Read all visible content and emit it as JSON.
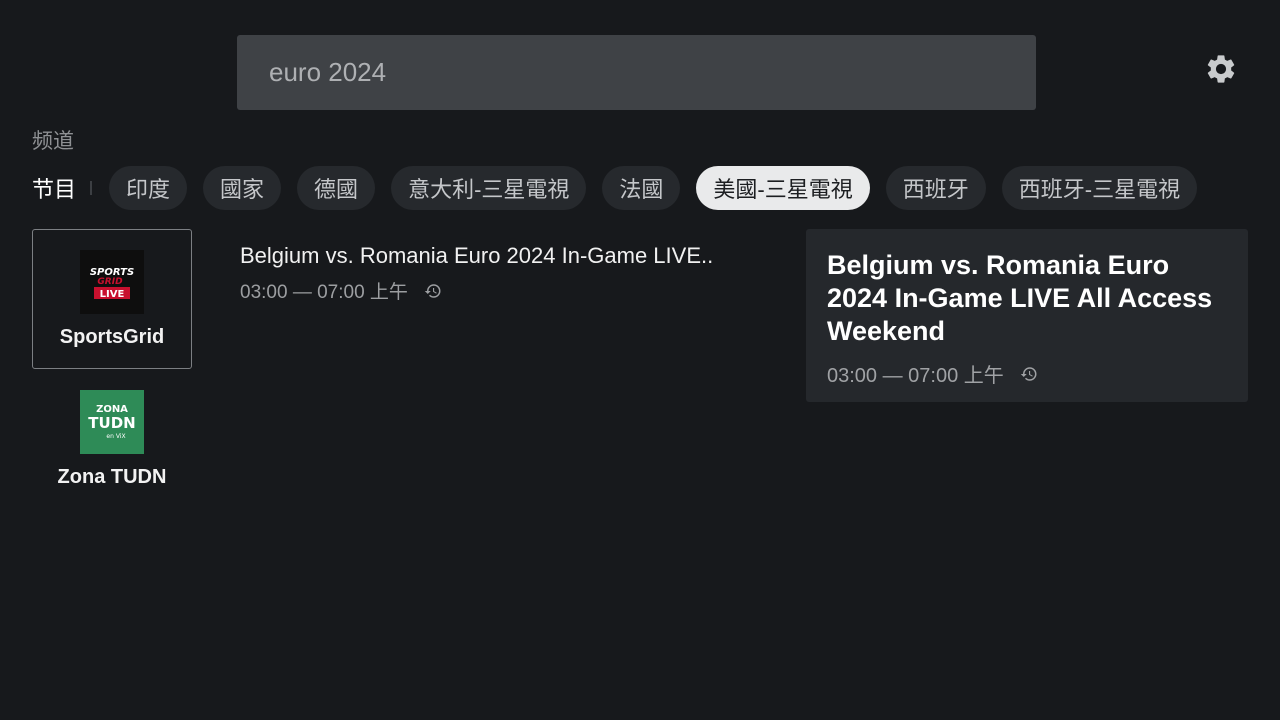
{
  "search": {
    "query": "euro 2024"
  },
  "section": {
    "channels_label": "频道"
  },
  "filters": {
    "current": "节目",
    "chips": [
      {
        "label": "印度",
        "selected": false
      },
      {
        "label": "國家",
        "selected": false
      },
      {
        "label": "德國",
        "selected": false
      },
      {
        "label": "意大利-三星電視",
        "selected": false
      },
      {
        "label": "法國",
        "selected": false
      },
      {
        "label": "美國-三星電視",
        "selected": true
      },
      {
        "label": "西班牙",
        "selected": false
      },
      {
        "label": "西班牙-三星電視",
        "selected": false
      }
    ]
  },
  "channels": [
    {
      "name": "SportsGrid",
      "logo_text": [
        "SPORTS",
        "GRID",
        "LIVE"
      ]
    },
    {
      "name": "Zona TUDN",
      "logo_text": [
        "ZONA",
        "TUDN",
        "en ViX"
      ]
    }
  ],
  "program": {
    "title": "Belgium vs. Romania Euro 2024 In-Game LIVE..",
    "time": "03:00 — 07:00 上午"
  },
  "detail": {
    "title": "Belgium vs. Romania Euro 2024 In-Game LIVE All Access Weekend",
    "time": "03:00 — 07:00 上午"
  },
  "icons": {
    "settings": "gear-icon",
    "replay": "history-icon"
  },
  "colors": {
    "background": "#17191c",
    "search_bg": "#3f4246",
    "chip_bg": "#26292d",
    "chip_selected_bg": "#e9eaeb",
    "detail_bg": "#25282c",
    "sportsgrid_red": "#c8102e",
    "tudn_green": "#2e8b57"
  }
}
